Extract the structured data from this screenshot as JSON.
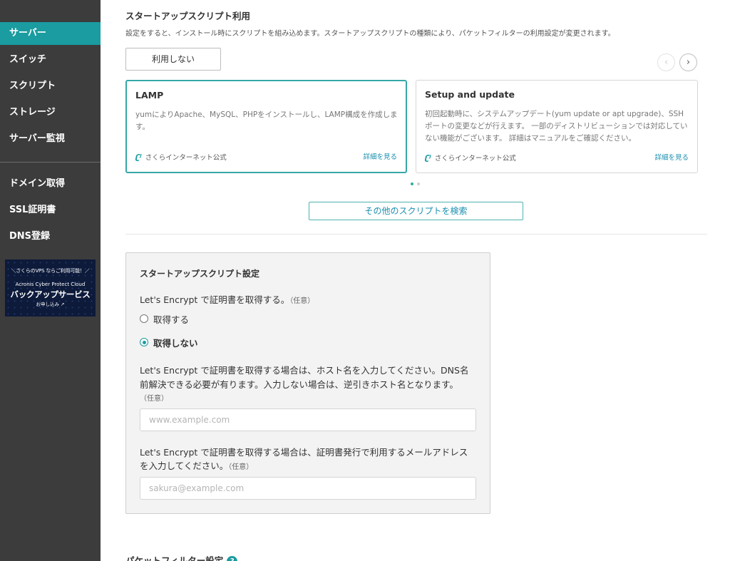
{
  "sidebar": {
    "items": [
      {
        "label": "サーバー",
        "active": true
      },
      {
        "label": "スイッチ"
      },
      {
        "label": "スクリプト"
      },
      {
        "label": "ストレージ"
      },
      {
        "label": "サーバー監視"
      }
    ],
    "items2": [
      {
        "label": "ドメイン取得"
      },
      {
        "label": "SSL証明書"
      },
      {
        "label": "DNS登録"
      }
    ],
    "banner": {
      "line1": "＼さくらのVPS ならご利用可能！／",
      "line2": "Acronis Cyber Protect Cloud",
      "line3": "バックアップサービス",
      "line4": "お申し込み ↗"
    }
  },
  "startup": {
    "title": "スタートアップスクリプト利用",
    "description": "設定をすると、インストール時にスクリプトを組み込めます。スタートアップスクリプトの種類により、パケットフィルターの利用設定が変更されます。",
    "none_button": "利用しない",
    "prev_arrow": "‹",
    "next_arrow": "›",
    "cards": [
      {
        "title": "LAMP",
        "description": "yumによりApache、MySQL、PHPをインストールし、LAMP構成を作成します。",
        "vendor": "さくらインターネット公式",
        "link": "詳細を見る"
      },
      {
        "title": "Setup and update",
        "description": "初回起動時に、システムアップデート(yum update or apt upgrade)、SSHポートの変更などが行えます。 一部のディストリビューションでは対応していない機能がございます。 詳細はマニュアルをご確認ください。",
        "vendor": "さくらインターネット公式",
        "link": "詳細を見る"
      }
    ],
    "vendor_logo": "ʗʲ",
    "search_button": "その他のスクリプトを検索"
  },
  "settings": {
    "title": "スタートアップスクリプト設定",
    "q1": "Let's Encrypt で証明書を取得する。",
    "q1_opt": "（任意）",
    "radio_get": "取得する",
    "radio_noget": "取得しない",
    "q2_line1": "Let's Encrypt で証明書を取得する場合は、ホスト名を入力してください。DNS名",
    "q2_line2": "前解決できる必要が有ります。入力しない場合は、逆引きホスト名となります。",
    "q2_opt": "（任意）",
    "host_placeholder": "www.example.com",
    "q3_line1": "Let's Encrypt で証明書を取得する場合は、証明書発行で利用するメールアドレス",
    "q3_line2": "を入力してください。",
    "q3_opt": "（任意）",
    "email_placeholder": "sakura@example.com"
  },
  "packet_filter": {
    "title": "パケットフィルター設定",
    "help": "?"
  }
}
